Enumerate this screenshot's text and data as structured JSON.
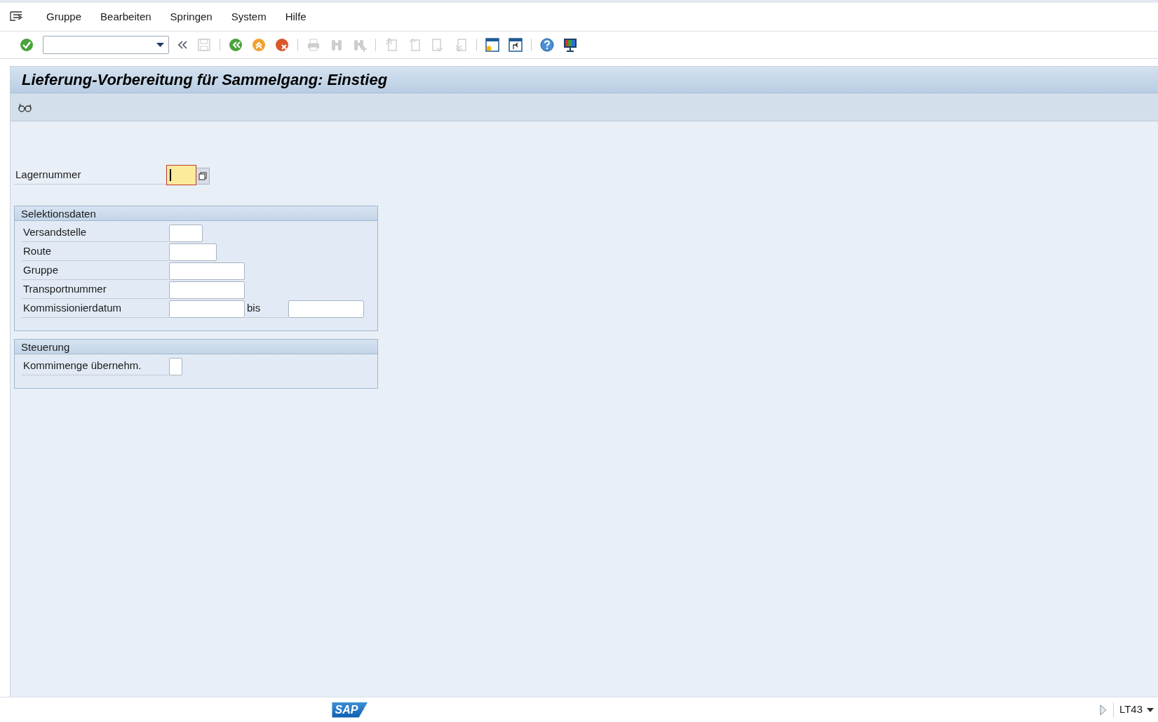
{
  "menu_bar": {
    "items": [
      "Gruppe",
      "Bearbeiten",
      "Springen",
      "System",
      "Hilfe"
    ]
  },
  "toolbar": {
    "items": [
      {
        "kind": "enter",
        "disabled": false
      },
      {
        "kind": "command-field"
      },
      {
        "kind": "collapse",
        "disabled": false
      },
      {
        "kind": "save",
        "disabled": true
      },
      {
        "kind": "separator"
      },
      {
        "kind": "back",
        "disabled": false
      },
      {
        "kind": "exit",
        "disabled": false
      },
      {
        "kind": "cancel",
        "disabled": false
      },
      {
        "kind": "separator"
      },
      {
        "kind": "print",
        "disabled": true
      },
      {
        "kind": "find",
        "disabled": true
      },
      {
        "kind": "find-next",
        "disabled": true
      },
      {
        "kind": "separator"
      },
      {
        "kind": "first-page",
        "disabled": true
      },
      {
        "kind": "prev-page",
        "disabled": true
      },
      {
        "kind": "next-page",
        "disabled": true
      },
      {
        "kind": "last-page",
        "disabled": true
      },
      {
        "kind": "separator"
      },
      {
        "kind": "new-session",
        "disabled": false
      },
      {
        "kind": "shortcut",
        "disabled": false
      },
      {
        "kind": "separator"
      },
      {
        "kind": "help",
        "disabled": false
      },
      {
        "kind": "layout",
        "disabled": false
      }
    ]
  },
  "title": "Lieferung-Vorbereitung für Sammelgang: Einstieg",
  "lagernummer": {
    "label": "Lagernummer",
    "focused": true,
    "required": true
  },
  "groups": [
    {
      "title": "Selektionsdaten",
      "rows": [
        {
          "kind": "field",
          "label": "Versandstelle"
        },
        {
          "kind": "field",
          "label": "Route"
        },
        {
          "kind": "field",
          "label": "Gruppe"
        },
        {
          "kind": "field",
          "label": "Transportnummer"
        },
        {
          "kind": "range",
          "label": "Kommissionierdatum",
          "to_label": "bis"
        }
      ]
    },
    {
      "title": "Steuerung",
      "rows": [
        {
          "kind": "checkbox",
          "label": "Kommimenge übernehm.",
          "checked": false
        }
      ]
    }
  ],
  "status_bar": {
    "logo": "SAP",
    "transaction": "LT43"
  }
}
